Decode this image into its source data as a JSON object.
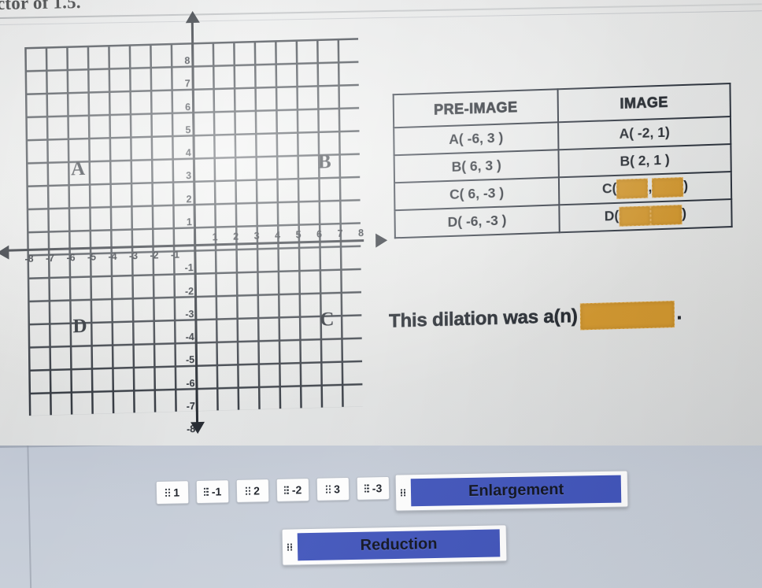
{
  "heading": {
    "cut_off_text": "ctor of 1.5."
  },
  "graph": {
    "x_ticks": [
      "-8",
      "-7",
      "-6",
      "-5",
      "-4",
      "-3",
      "-2",
      "-1",
      "1",
      "2",
      "3",
      "4",
      "5",
      "6",
      "7",
      "8"
    ],
    "y_ticks_positive": [
      "8",
      "7",
      "6",
      "5",
      "4",
      "3",
      "2",
      "1"
    ],
    "y_ticks_negative": [
      "-1",
      "-2",
      "-3",
      "-4",
      "-5",
      "-6",
      "-7",
      "-8"
    ],
    "points": [
      {
        "label": "A",
        "x": -6,
        "y": 3
      },
      {
        "label": "B",
        "x": 6,
        "y": 3
      },
      {
        "label": "C",
        "x": 6,
        "y": -3
      },
      {
        "label": "D",
        "x": -6,
        "y": -3
      }
    ]
  },
  "table": {
    "headers": [
      "PRE-IMAGE",
      "IMAGE"
    ],
    "rows": [
      {
        "pre_image": "A( -6, 3 )",
        "image_text": "A( -2, 1)",
        "image_blank": false
      },
      {
        "pre_image": "B( 6, 3 )",
        "image_text": "B( 2, 1 )",
        "image_blank": false
      },
      {
        "pre_image": "C( 6, -3 )",
        "image_prefix": "C(",
        "image_sep": ",",
        "image_suffix": ")",
        "image_blank": true
      },
      {
        "pre_image": "D( -6, -3 )",
        "image_prefix": "D(",
        "image_sep": "",
        "image_suffix": ")",
        "image_blank": true
      }
    ]
  },
  "sentence": {
    "prefix": "This dilation was a(n)",
    "suffix": "."
  },
  "answer_bank": {
    "grip_icon": "drag-handle-icon",
    "number_tiles": [
      "1",
      "-1",
      "2",
      "-2",
      "3",
      "-3"
    ],
    "word_tiles": [
      "Enlargement",
      "Reduction"
    ]
  },
  "colors": {
    "blank_orange": "#d89a2c",
    "tile_blue": "#3f53ba",
    "panel_bg": "#c5ccd7",
    "ink": "#23282f"
  }
}
